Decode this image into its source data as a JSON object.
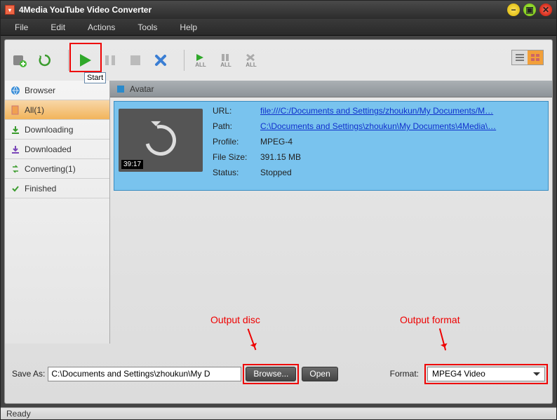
{
  "window": {
    "title": "4Media YouTube Video Converter"
  },
  "menu": {
    "file": "File",
    "edit": "Edit",
    "actions": "Actions",
    "tools": "Tools",
    "help": "Help"
  },
  "toolbar": {
    "startHint": "Start",
    "allLabel": "ALL"
  },
  "sidebar": {
    "browser": "Browser",
    "all": "All(1)",
    "downloading": "Downloading",
    "downloaded": "Downloaded",
    "converting": "Converting(1)",
    "finished": "Finished"
  },
  "tab": {
    "title": "Avatar"
  },
  "item": {
    "duration": "39:17",
    "urlLabel": "URL:",
    "url": "file:///C:/Documents and Settings/zhoukun/My Documents/M…",
    "pathLabel": "Path:",
    "path": "C:\\Documents and Settings\\zhoukun\\My Documents\\4Media\\…",
    "profileLabel": "Profile:",
    "profile": "MPEG-4",
    "sizeLabel": "File Size:",
    "size": "391.15 MB",
    "statusLabel": "Status:",
    "status": "Stopped"
  },
  "annotations": {
    "outputDisc": "Output disc",
    "outputFormat": "Output format"
  },
  "footer": {
    "saveAsLabel": "Save As:",
    "saveAsValue": "C:\\Documents and Settings\\zhoukun\\My D",
    "browse": "Browse...",
    "open": "Open",
    "formatLabel": "Format:",
    "formatValue": "MPEG4 Video"
  },
  "status": {
    "text": "Ready"
  }
}
